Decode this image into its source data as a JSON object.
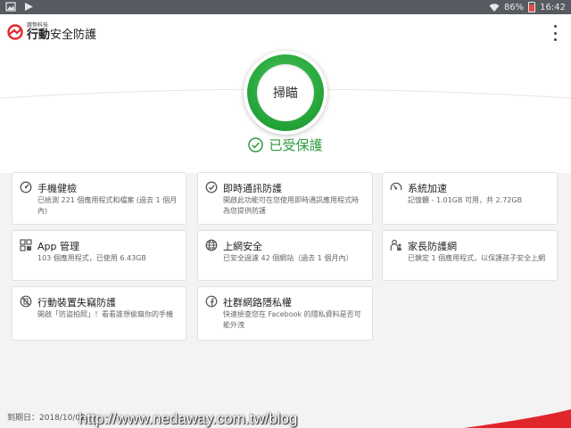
{
  "status_bar": {
    "battery": "86%",
    "time": "16:42"
  },
  "app": {
    "logo_small": "趨勢科技",
    "logo_bold": "行動",
    "logo_rest": "安全防護",
    "menu_icon": "more-vert-icon",
    "brand_color": "#e0262b"
  },
  "scan": {
    "button_label": "掃瞄",
    "status_text": "已受保護",
    "status_color": "#2e9b3e"
  },
  "cards": [
    {
      "icon": "gauge-icon",
      "title": "手機健檢",
      "desc": "已檢測 221 個應用程式和檔案 (過去 1 個月內)"
    },
    {
      "icon": "chat-shield-icon",
      "title": "即時通訊防護",
      "desc": "開啟此功能可在您使用即時通訊應用程式時為您提供防護"
    },
    {
      "icon": "speed-gauge-icon",
      "title": "系統加速",
      "desc": "記憶體 - 1.01GB 可用，共 2.72GB"
    },
    {
      "icon": "app-grid-icon",
      "title": "App 管理",
      "desc": "103 個應用程式，已使用 6.43GB"
    },
    {
      "icon": "globe-icon",
      "title": "上網安全",
      "desc": "已安全過濾 42 個網站（過去 1 個月內）"
    },
    {
      "icon": "parent-child-icon",
      "title": "家長防護網",
      "desc": "已鎖定 1 個應用程式，以保護孩子安全上網"
    },
    {
      "icon": "lost-device-icon",
      "title": "行動裝置失竊防護",
      "desc": "開啟「防盜拍照」！看看誰想偷窺你的手機"
    },
    {
      "icon": "facebook-icon",
      "title": "社群網路隱私權",
      "desc": "快速檢查您在 Facebook 的隱私資料是否可能外洩"
    }
  ],
  "footer": {
    "expiry_text": "到期日：2018/10/02",
    "watermark": "http://www.nedaway.com.tw/blog"
  }
}
